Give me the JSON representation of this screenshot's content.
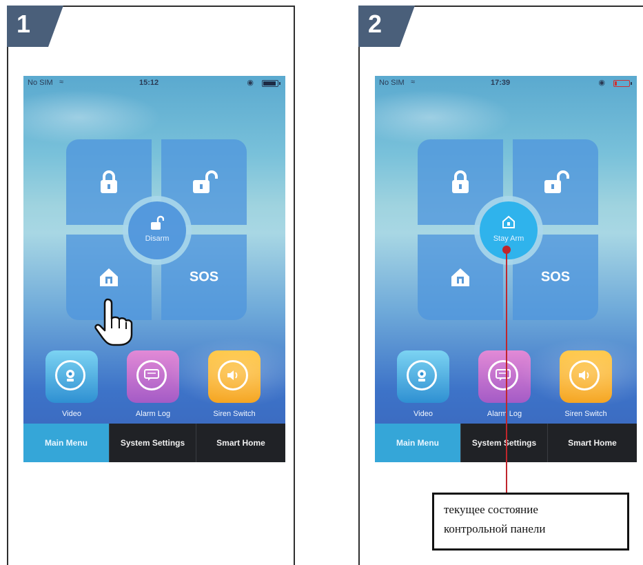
{
  "panels": [
    {
      "step": "1",
      "status_bar": {
        "carrier": "No SIM",
        "time": "15:12",
        "battery_level": 0.8
      },
      "center_button": {
        "label": "Disarm"
      },
      "sos_label": "SOS",
      "apps": [
        {
          "label": "Video"
        },
        {
          "label": "Alarm Log"
        },
        {
          "label": "Siren Switch"
        }
      ],
      "tabs": [
        {
          "label": "Main Menu"
        },
        {
          "label": "System Settings"
        },
        {
          "label": "Smart Home"
        }
      ]
    },
    {
      "step": "2",
      "status_bar": {
        "carrier": "No SIM",
        "time": "17:39",
        "battery_level": 0.1
      },
      "center_button": {
        "label": "Stay Arm"
      },
      "sos_label": "SOS",
      "apps": [
        {
          "label": "Video"
        },
        {
          "label": "Alarm Log"
        },
        {
          "label": "Siren Switch"
        }
      ],
      "tabs": [
        {
          "label": "Main Menu"
        },
        {
          "label": "System Settings"
        },
        {
          "label": "Smart Home"
        }
      ]
    }
  ],
  "annotation": {
    "line1": "текущее состояние",
    "line2": "контрольной панели"
  },
  "colors": {
    "badge": "#4a5f7a",
    "active_tab": "#35a6d8",
    "tabbar": "#202226",
    "annotation_line": "#c0262c",
    "active_center": "#2fb3ec"
  },
  "icons": {
    "arm_away": "padlock-closed-icon",
    "disarm": "padlock-open-icon",
    "stay_arm": "home-lock-icon",
    "video": "camera-icon",
    "alarm_log": "chat-log-icon",
    "siren": "speaker-icon",
    "pointer": "pointing-hand-icon"
  }
}
